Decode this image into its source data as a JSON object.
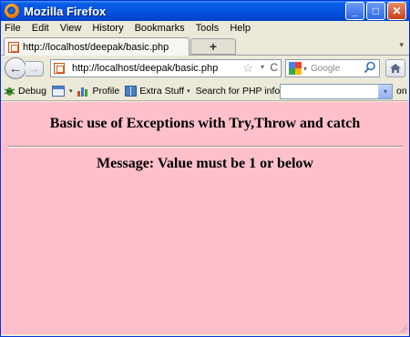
{
  "window": {
    "title": "Mozilla Firefox",
    "minimize": "_",
    "maximize": "□",
    "close": "✕"
  },
  "menu": [
    "File",
    "Edit",
    "View",
    "History",
    "Bookmarks",
    "Tools",
    "Help"
  ],
  "tab": {
    "label": "http://localhost/deepak/basic.php",
    "new_tab": "+",
    "chevron": "▾"
  },
  "nav": {
    "back": "←",
    "forward": "→",
    "url": "http://localhost/deepak/basic.php",
    "star": "☆",
    "url_dropdown": "▾",
    "reload": "C",
    "search_placeholder": "Google",
    "search_dropdown": "▾"
  },
  "bookmarks": {
    "debug": "Debug",
    "dropdown": "▾",
    "profile": "Profile",
    "extra": "Extra Stuff",
    "search_label": "Search for PHP information:",
    "select_arrow": "▾",
    "on": "on"
  },
  "page": {
    "title": "Basic use of Exceptions with Try,Throw and catch",
    "message": "Message: Value must be 1 or below",
    "background": "#ffc0cb"
  }
}
